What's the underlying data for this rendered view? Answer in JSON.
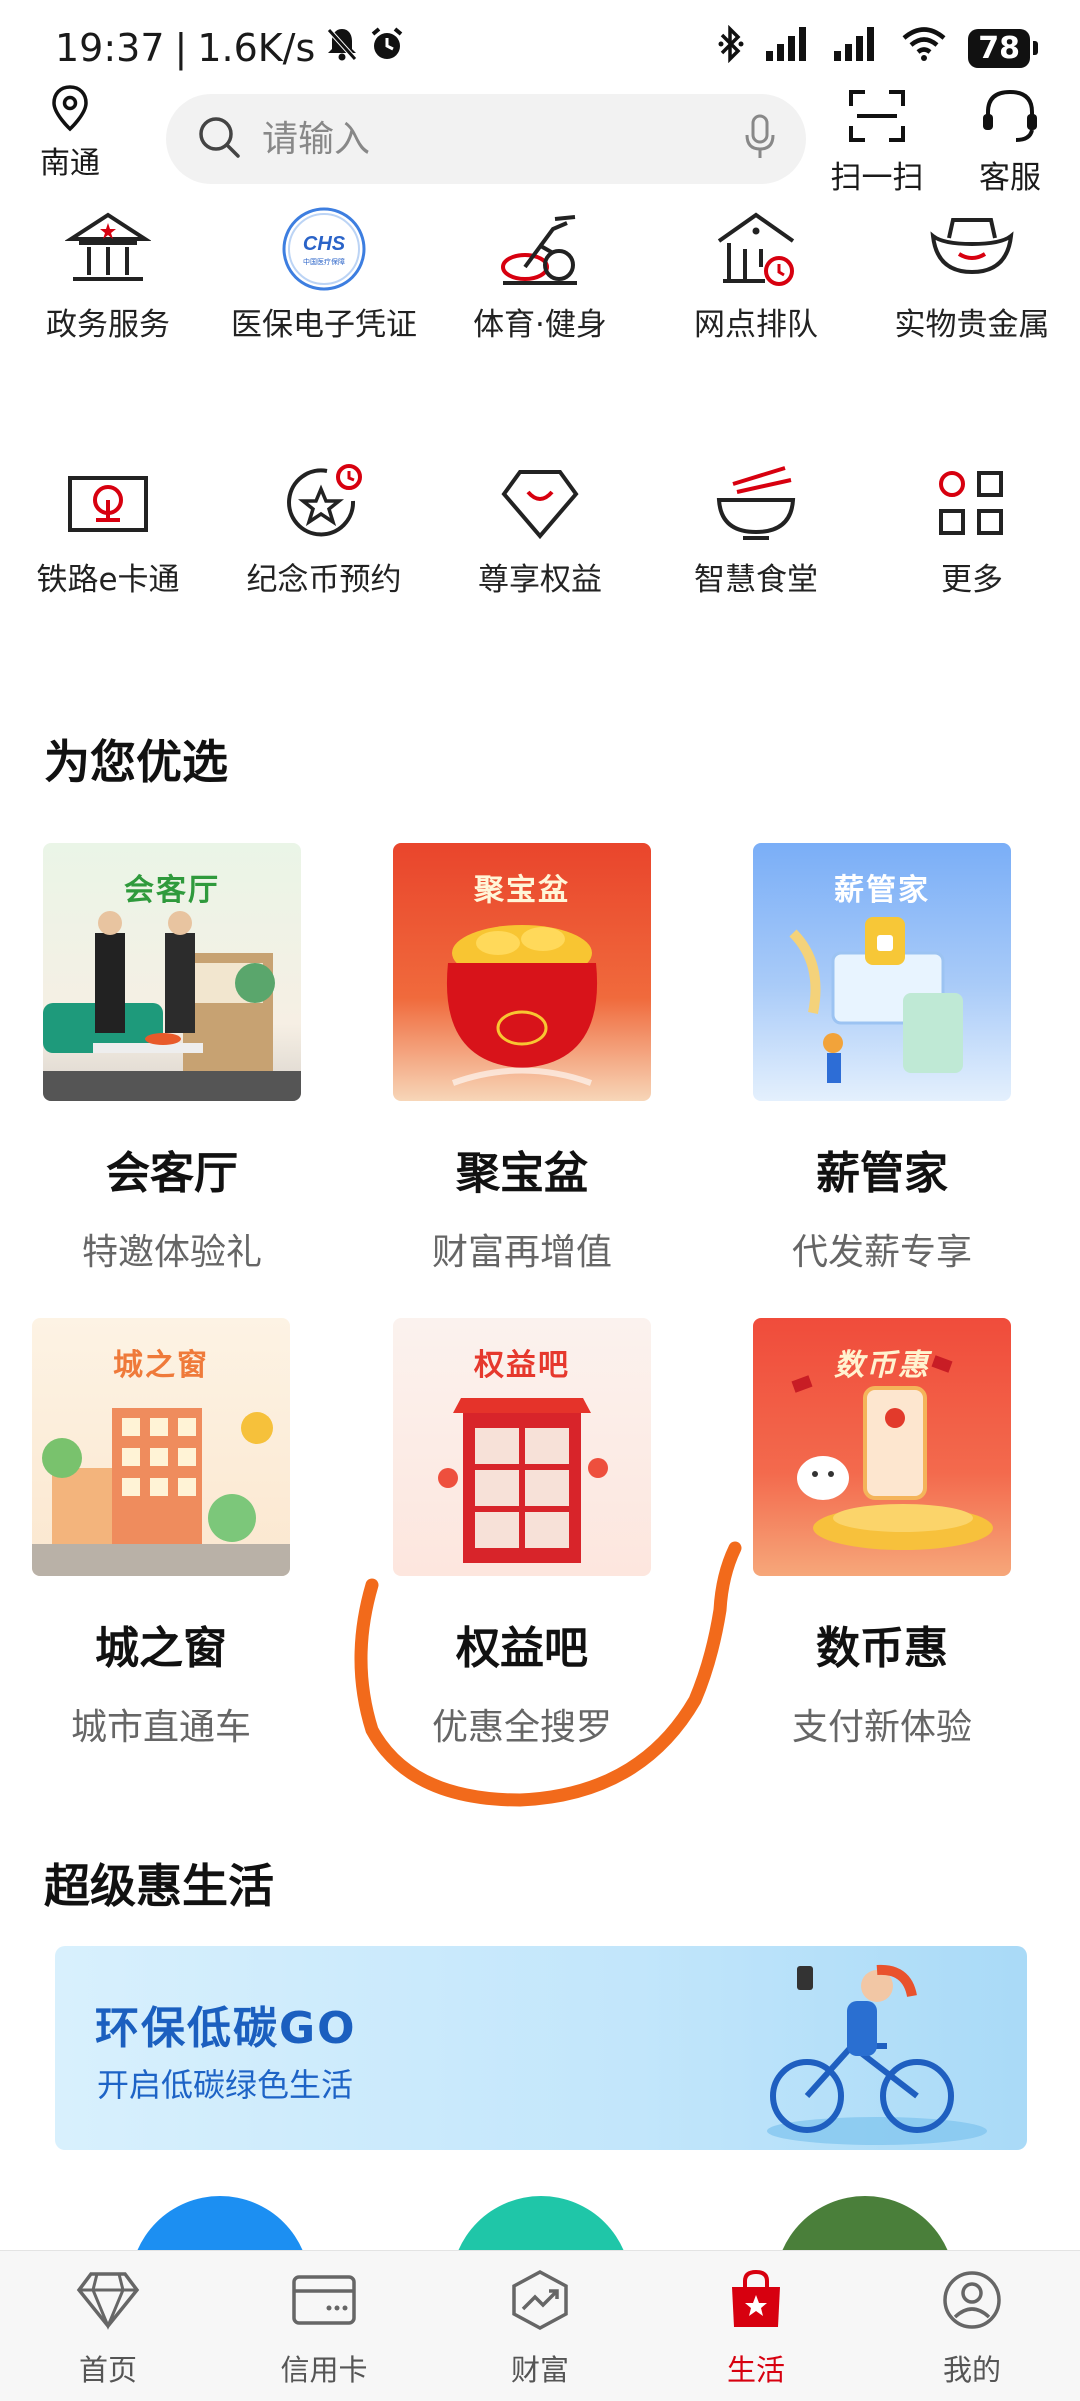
{
  "status_bar": {
    "time": "19:37",
    "network_speed": "1.6K/s",
    "battery": "78",
    "icons": [
      "mute-icon",
      "alarm-icon",
      "bluetooth-icon",
      "signal-icon",
      "signal-icon",
      "wifi-icon"
    ]
  },
  "top_bar": {
    "location": "南通",
    "search_placeholder": "请输入",
    "scan_label": "扫一扫",
    "service_label": "客服"
  },
  "services": [
    {
      "label": "政务服务",
      "icon": "government-building-icon"
    },
    {
      "label": "医保电子凭证",
      "icon": "chs-medical-insurance-icon",
      "icon_text": "CHS",
      "icon_subtext": "中国医疗保障"
    },
    {
      "label": "体育·健身",
      "icon": "exercise-bike-icon"
    },
    {
      "label": "网点排队",
      "icon": "branch-queue-icon"
    },
    {
      "label": "实物贵金属",
      "icon": "gold-ingot-icon"
    },
    {
      "label": "铁路e卡通",
      "icon": "railway-card-icon"
    },
    {
      "label": "纪念币预约",
      "icon": "commemorative-coin-icon"
    },
    {
      "label": "尊享权益",
      "icon": "diamond-privilege-icon"
    },
    {
      "label": "智慧食堂",
      "icon": "noodle-bowl-icon"
    },
    {
      "label": "更多",
      "icon": "more-grid-icon"
    }
  ],
  "featured": {
    "title": "为您优选",
    "cards": [
      {
        "img_title": "会客厅",
        "name": "会客厅",
        "sub": "特邀体验礼"
      },
      {
        "img_title": "聚宝盆",
        "name": "聚宝盆",
        "sub": "财富再增值"
      },
      {
        "img_title": "薪管家",
        "name": "薪管家",
        "sub": "代发薪专享"
      },
      {
        "img_title": "城之窗",
        "name": "城之窗",
        "sub": "城市直通车"
      },
      {
        "img_title": "权益吧",
        "name": "权益吧",
        "sub": "优惠全搜罗"
      },
      {
        "img_title": "数币惠",
        "name": "数币惠",
        "sub": "支付新体验"
      }
    ]
  },
  "life": {
    "title": "超级惠生活",
    "banner_title": "环保低碳GO",
    "banner_sub": "开启低碳绿色生活"
  },
  "bottom_nav": [
    {
      "label": "首页",
      "icon": "diamond-home-icon",
      "active": false
    },
    {
      "label": "信用卡",
      "icon": "credit-card-icon",
      "active": false
    },
    {
      "label": "财富",
      "icon": "wealth-chart-icon",
      "active": false
    },
    {
      "label": "生活",
      "icon": "shopping-bag-star-icon",
      "active": true
    },
    {
      "label": "我的",
      "icon": "user-profile-icon",
      "active": false
    }
  ],
  "colors": {
    "accent_red": "#d7000f",
    "annotation_orange": "#f26a1b",
    "banner_blue": "#1b5fbf"
  }
}
